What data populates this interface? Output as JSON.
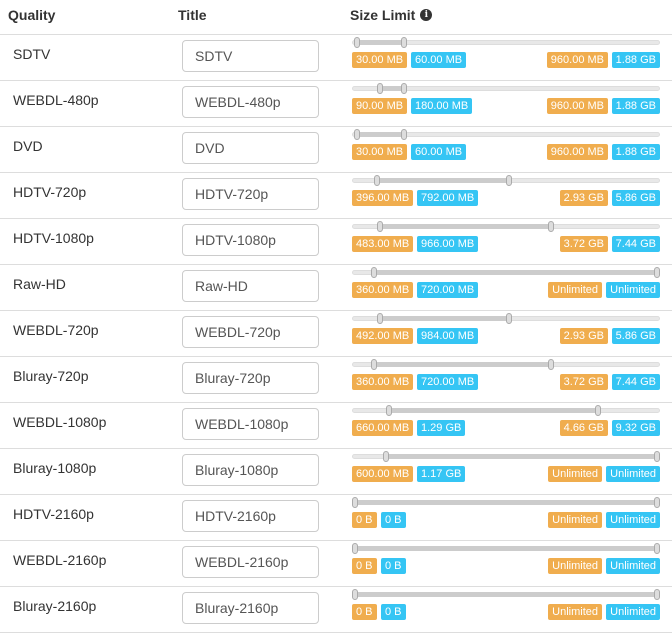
{
  "header": {
    "quality": "Quality",
    "title": "Title",
    "size_limit": "Size Limit"
  },
  "rows": [
    {
      "quality": "SDTV",
      "title": "SDTV",
      "min": "30.00 MB",
      "pref": "60.00 MB",
      "max": "960.00 MB",
      "cap": "1.88 GB",
      "h": [
        0.015,
        0.17,
        null
      ]
    },
    {
      "quality": "WEBDL-480p",
      "title": "WEBDL-480p",
      "min": "90.00 MB",
      "pref": "180.00 MB",
      "max": "960.00 MB",
      "cap": "1.88 GB",
      "h": [
        0.09,
        0.17,
        null
      ]
    },
    {
      "quality": "DVD",
      "title": "DVD",
      "min": "30.00 MB",
      "pref": "60.00 MB",
      "max": "960.00 MB",
      "cap": "1.88 GB",
      "h": [
        0.015,
        0.17,
        null
      ]
    },
    {
      "quality": "HDTV-720p",
      "title": "HDTV-720p",
      "min": "396.00 MB",
      "pref": "792.00 MB",
      "max": "2.93 GB",
      "cap": "5.86 GB",
      "h": [
        0.08,
        0.51,
        null
      ]
    },
    {
      "quality": "HDTV-1080p",
      "title": "HDTV-1080p",
      "min": "483.00 MB",
      "pref": "966.00 MB",
      "max": "3.72 GB",
      "cap": "7.44 GB",
      "h": [
        0.09,
        0.645,
        null
      ]
    },
    {
      "quality": "Raw-HD",
      "title": "Raw-HD",
      "min": "360.00 MB",
      "pref": "720.00 MB",
      "max": "Unlimited",
      "cap": "Unlimited",
      "h": [
        0.07,
        1,
        null
      ]
    },
    {
      "quality": "WEBDL-720p",
      "title": "WEBDL-720p",
      "min": "492.00 MB",
      "pref": "984.00 MB",
      "max": "2.93 GB",
      "cap": "5.86 GB",
      "h": [
        0.09,
        0.51,
        null
      ]
    },
    {
      "quality": "Bluray-720p",
      "title": "Bluray-720p",
      "min": "360.00 MB",
      "pref": "720.00 MB",
      "max": "3.72 GB",
      "cap": "7.44 GB",
      "h": [
        0.07,
        0.645,
        null
      ]
    },
    {
      "quality": "WEBDL-1080p",
      "title": "WEBDL-1080p",
      "min": "660.00 MB",
      "pref": "1.29 GB",
      "max": "4.66 GB",
      "cap": "9.32 GB",
      "h": [
        0.12,
        0.8,
        null
      ]
    },
    {
      "quality": "Bluray-1080p",
      "title": "Bluray-1080p",
      "min": "600.00 MB",
      "pref": "1.17 GB",
      "max": "Unlimited",
      "cap": "Unlimited",
      "h": [
        0.11,
        1,
        null
      ]
    },
    {
      "quality": "HDTV-2160p",
      "title": "HDTV-2160p",
      "min": "0 B",
      "pref": "0 B",
      "max": "Unlimited",
      "cap": "Unlimited",
      "h": [
        0,
        1,
        null
      ]
    },
    {
      "quality": "WEBDL-2160p",
      "title": "WEBDL-2160p",
      "min": "0 B",
      "pref": "0 B",
      "max": "Unlimited",
      "cap": "Unlimited",
      "h": [
        0,
        1,
        null
      ]
    },
    {
      "quality": "Bluray-2160p",
      "title": "Bluray-2160p",
      "min": "0 B",
      "pref": "0 B",
      "max": "Unlimited",
      "cap": "Unlimited",
      "h": [
        0,
        1,
        null
      ]
    }
  ],
  "colors": {
    "min_badge": "#f0ad4e",
    "pref_badge": "#35c5f4",
    "max_badge": "#f0ad4e",
    "cap_badge": "#35c5f4"
  }
}
